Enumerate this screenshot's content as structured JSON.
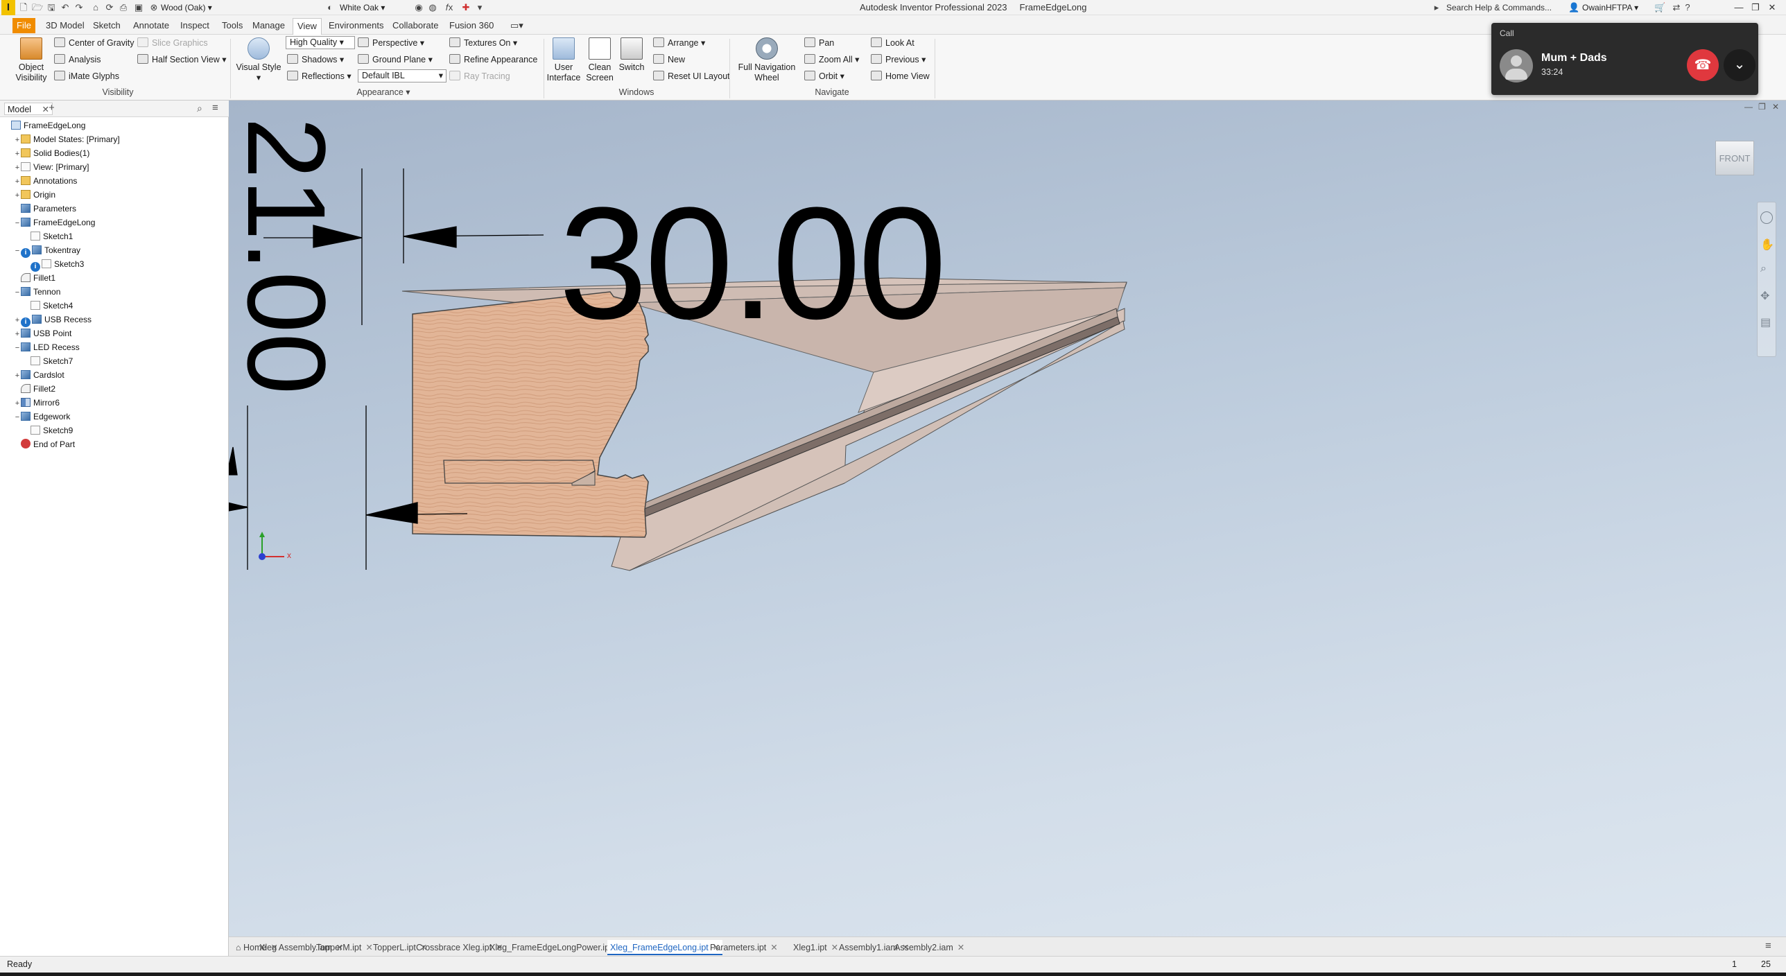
{
  "titlebar": {
    "app_logo": "I",
    "material": "Wood (Oak)",
    "appearance": "White Oak",
    "app_title": "Autodesk Inventor Professional 2023",
    "document_title": "FrameEdgeLong",
    "search_placeholder": "Search Help & Commands...",
    "user": "OwainHFTPA"
  },
  "ribbon_tabs": [
    "File",
    "3D Model",
    "Sketch",
    "Annotate",
    "Inspect",
    "Tools",
    "Manage",
    "View",
    "Environments",
    "Collaborate",
    "Fusion 360"
  ],
  "ribbon": {
    "visibility": {
      "object_visibility": "Object Visibility",
      "center_of_gravity": "Center of Gravity",
      "slice_graphics": "Slice Graphics",
      "analysis": "Analysis",
      "half_section_view": "Half Section View",
      "imate_glyphs": "iMate Glyphs",
      "group_label": "Visibility"
    },
    "appearance": {
      "visual_style": "Visual Style",
      "quality": "High Quality",
      "perspective": "Perspective",
      "textures_on": "Textures On",
      "shadows": "Shadows",
      "ground_plane": "Ground Plane",
      "refine_appearance": "Refine Appearance",
      "reflections": "Reflections",
      "ibl": "Default IBL",
      "ray_tracing": "Ray Tracing",
      "group_label": "Appearance"
    },
    "windows": {
      "user_interface": "User Interface",
      "clean_screen": "Clean Screen",
      "switch": "Switch",
      "arrange": "Arrange",
      "new": "New",
      "reset_ui": "Reset UI Layout",
      "group_label": "Windows"
    },
    "navigate": {
      "full_nav_wheel": "Full Navigation Wheel",
      "pan": "Pan",
      "zoom_all": "Zoom All",
      "orbit": "Orbit",
      "look_at": "Look At",
      "previous": "Previous",
      "home_view": "Home View",
      "group_label": "Navigate"
    }
  },
  "browser": {
    "tab": "Model",
    "tree": [
      {
        "label": "FrameEdgeLong",
        "indent": 0,
        "icon": "part",
        "expander": ""
      },
      {
        "label": "Model States: [Primary]",
        "indent": 1,
        "icon": "folder",
        "expander": "+"
      },
      {
        "label": "Solid Bodies(1)",
        "indent": 1,
        "icon": "folder",
        "expander": "+"
      },
      {
        "label": "View: [Primary]",
        "indent": 1,
        "icon": "sketch",
        "expander": "+"
      },
      {
        "label": "Annotations",
        "indent": 1,
        "icon": "folder",
        "expander": "+"
      },
      {
        "label": "Origin",
        "indent": 1,
        "icon": "folder",
        "expander": "+"
      },
      {
        "label": "Parameters",
        "indent": 1,
        "icon": "feature",
        "expander": ""
      },
      {
        "label": "FrameEdgeLong",
        "indent": 1,
        "icon": "feature",
        "expander": "−"
      },
      {
        "label": "Sketch1",
        "indent": 2,
        "icon": "sketch",
        "expander": ""
      },
      {
        "label": "Tokentray",
        "indent": 1,
        "icon": "feature",
        "expander": "−",
        "info": true
      },
      {
        "label": "Sketch3",
        "indent": 2,
        "icon": "sketch",
        "expander": "",
        "info": true
      },
      {
        "label": "Fillet1",
        "indent": 1,
        "icon": "fillet",
        "expander": ""
      },
      {
        "label": "Tennon",
        "indent": 1,
        "icon": "feature",
        "expander": "−"
      },
      {
        "label": "Sketch4",
        "indent": 2,
        "icon": "sketch",
        "expander": ""
      },
      {
        "label": "USB Recess",
        "indent": 1,
        "icon": "feature",
        "expander": "+",
        "info": true
      },
      {
        "label": "USB Point",
        "indent": 1,
        "icon": "feature",
        "expander": "+"
      },
      {
        "label": "LED Recess",
        "indent": 1,
        "icon": "feature",
        "expander": "−"
      },
      {
        "label": "Sketch7",
        "indent": 2,
        "icon": "sketch",
        "expander": ""
      },
      {
        "label": "Cardslot",
        "indent": 1,
        "icon": "feature",
        "expander": "+"
      },
      {
        "label": "Fillet2",
        "indent": 1,
        "icon": "fillet",
        "expander": ""
      },
      {
        "label": "Mirror6",
        "indent": 1,
        "icon": "mirror",
        "expander": "+"
      },
      {
        "label": "Edgework",
        "indent": 1,
        "icon": "feature",
        "expander": "−"
      },
      {
        "label": "Sketch9",
        "indent": 2,
        "icon": "sketch",
        "expander": ""
      },
      {
        "label": "End of Part",
        "indent": 1,
        "icon": "end",
        "expander": ""
      }
    ]
  },
  "viewport": {
    "dimension_horizontal": "30.00",
    "dimension_vertical": "21.00",
    "viewcube_face": "FRONT",
    "triad_x": "x"
  },
  "doc_tabs": [
    {
      "label": "Home",
      "active": false
    },
    {
      "label": "Xleg Assembly.iam",
      "active": false
    },
    {
      "label": "TopperM.ipt",
      "active": false
    },
    {
      "label": "TopperL.ipt",
      "active": false
    },
    {
      "label": "Crossbrace Xleg.ipt",
      "active": false
    },
    {
      "label": "Xleg_FrameEdgeLongPower.ipt",
      "active": false
    },
    {
      "label": "Xleg_FrameEdgeLong.ipt",
      "active": true
    },
    {
      "label": "Parameters.ipt",
      "active": false
    },
    {
      "label": "Xleg1.ipt",
      "active": false
    },
    {
      "label": "Assembly1.iam",
      "active": false
    },
    {
      "label": "Assembly2.iam",
      "active": false
    }
  ],
  "status": {
    "text": "Ready",
    "count1": "1",
    "count2": "25"
  },
  "call": {
    "label": "Call",
    "name": "Mum + Dads",
    "duration": "33:24"
  },
  "colors": {
    "file_tab": "#f08c00",
    "active_doc_tab": "#1f66c2",
    "hangup": "#e0383e",
    "wood_light": "#e2b597",
    "wood_dark": "#c98e6c"
  }
}
